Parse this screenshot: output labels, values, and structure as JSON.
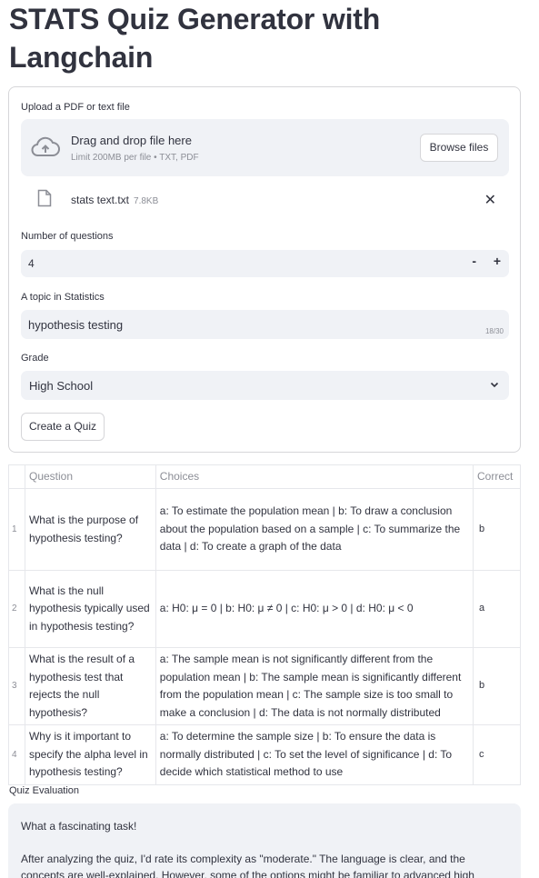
{
  "title": "STATS Quiz Generator with Langchain",
  "upload": {
    "label": "Upload a PDF or text file",
    "dropzone_main": "Drag and drop file here",
    "dropzone_sub": "Limit 200MB per file • TXT, PDF",
    "browse_label": "Browse files",
    "file_name": "stats text.txt",
    "file_size": "7.8KB"
  },
  "num_questions": {
    "label": "Number of questions",
    "value": "4",
    "minus": "-",
    "plus": "+"
  },
  "topic": {
    "label": "A topic in Statistics",
    "value": "hypothesis testing",
    "counter": "18/30"
  },
  "grade": {
    "label": "Grade",
    "value": "High School"
  },
  "create_button": "Create a Quiz",
  "table": {
    "headers": [
      "Question",
      "Choices",
      "Correct"
    ],
    "rows": [
      {
        "index": "1",
        "question": "What is the purpose of hypothesis testing?",
        "choices": "a: To estimate the population mean | b: To draw a conclusion about the population based on a sample | c: To summarize the data | d: To create a graph of the data",
        "correct": "b"
      },
      {
        "index": "2",
        "question": "What is the null hypothesis typically used in hypothesis testing?",
        "choices": "a: H0: μ = 0 | b: H0: μ ≠ 0 | c: H0: μ > 0 | d: H0: μ < 0",
        "correct": "a"
      },
      {
        "index": "3",
        "question": "What is the result of a hypothesis test that rejects the null hypothesis?",
        "choices": "a: The sample mean is not significantly different from the population mean | b: The sample mean is significantly different from the population mean | c: The sample size is too small to make a conclusion | d: The data is not normally distributed",
        "correct": "b"
      },
      {
        "index": "4",
        "question": "Why is it important to specify the alpha level in hypothesis testing?",
        "choices": "a: To determine the sample size | b: To ensure the data is normally distributed | c: To set the level of significance | d: To decide which statistical method to use",
        "correct": "c"
      }
    ]
  },
  "evaluation": {
    "label": "Quiz Evaluation",
    "line1": "What a fascinating task!",
    "line2": "After analyzing the quiz, I'd rate its complexity as \"moderate.\" The language is clear, and the concepts are well-explained. However, some of the options might be familiar to advanced high"
  }
}
